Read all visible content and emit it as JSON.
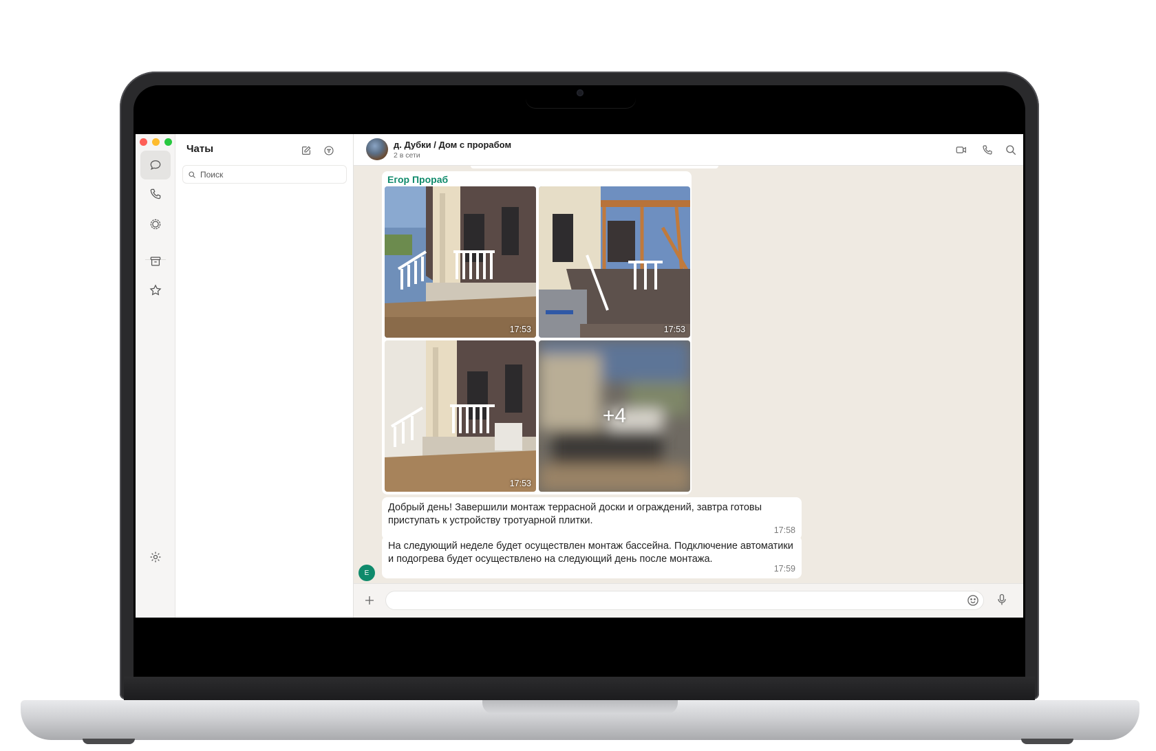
{
  "sidebar": {
    "title": "Чаты",
    "search_placeholder": "Поиск",
    "icons": [
      "chats-icon",
      "calls-icon",
      "status-icon",
      "archive-icon",
      "starred-icon",
      "settings-icon"
    ]
  },
  "chat": {
    "name": "д. Дубки / Дом с прорабом",
    "status": "2 в сети",
    "sender": "Егор Прораб",
    "sender_initial": "Е",
    "photos": [
      {
        "time": "17:53"
      },
      {
        "time": "17:53"
      },
      {
        "time": "17:53"
      },
      {
        "more": "+4"
      }
    ],
    "messages": [
      {
        "text": "Добрый день! Завершили монтаж террасной доски и ограждений, завтра готовы приступать к устройству тротуарной плитки.",
        "time": "17:58"
      },
      {
        "text": "На следующий неделе будет осуществлен монтаж бассейна. Подключение автоматики и подогрева будет осуществлено на следующий день после монтажа.",
        "time": "17:59"
      }
    ]
  },
  "colors": {
    "sender_name": "#0f8a6b",
    "chat_background": "#efeae2",
    "traffic_red": "#fe5f57",
    "traffic_yellow": "#febc2e",
    "traffic_green": "#28c840"
  }
}
